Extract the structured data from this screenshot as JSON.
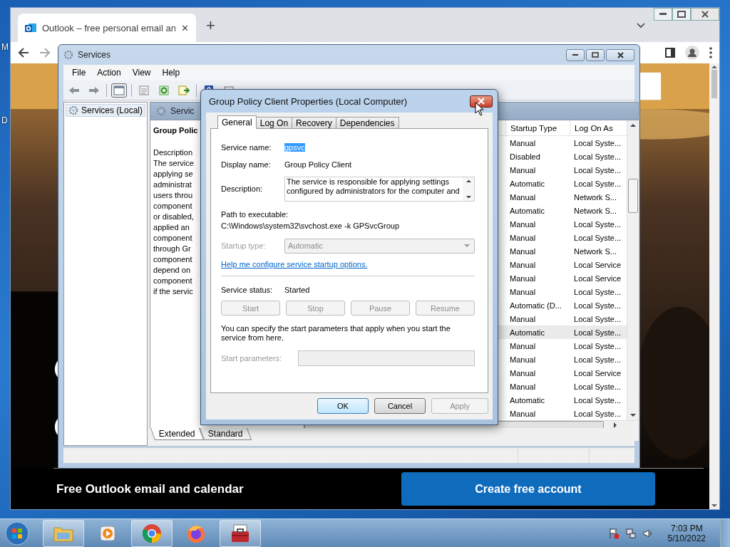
{
  "desktop": {
    "icon_labels": [
      "M",
      "D"
    ]
  },
  "browser": {
    "tab": {
      "title": "Outlook – free personal email an",
      "close": "✕"
    },
    "new_tab": "+",
    "page": {
      "kind": "picture",
      "headline": "Free Outlook email and calendar",
      "cta": "Create free account"
    }
  },
  "services_window": {
    "title": "Services",
    "menu": [
      "File",
      "Action",
      "View",
      "Help"
    ],
    "tree": [
      {
        "label": "Services (Local)",
        "selected": true
      }
    ],
    "pane_header": "Servic",
    "service_title": "Group Polic",
    "description_lines": [
      "Description",
      "The service",
      "applying se",
      "administrat",
      "users throu",
      "component",
      "or disabled,",
      "applied an",
      "component",
      "through Gr",
      "component",
      "depend on",
      "component",
      "if the servic"
    ],
    "columns": [
      "Startup Type",
      "Log On As"
    ],
    "rows": [
      {
        "startup_type": "Manual",
        "log_on_as": "Local Syste...",
        "selected": false
      },
      {
        "startup_type": "Disabled",
        "log_on_as": "Local Syste...",
        "selected": false
      },
      {
        "startup_type": "Manual",
        "log_on_as": "Local Syste...",
        "selected": false
      },
      {
        "startup_type": "Automatic",
        "log_on_as": "Local Syste...",
        "selected": false
      },
      {
        "startup_type": "Manual",
        "log_on_as": "Network S...",
        "selected": false
      },
      {
        "startup_type": "Automatic",
        "log_on_as": "Network S...",
        "selected": false
      },
      {
        "startup_type": "Manual",
        "log_on_as": "Local Syste...",
        "selected": false
      },
      {
        "startup_type": "Manual",
        "log_on_as": "Local Syste...",
        "selected": false
      },
      {
        "startup_type": "Manual",
        "log_on_as": "Network S...",
        "selected": false
      },
      {
        "startup_type": "Manual",
        "log_on_as": "Local Service",
        "selected": false
      },
      {
        "startup_type": "Manual",
        "log_on_as": "Local Service",
        "selected": false
      },
      {
        "startup_type": "Manual",
        "log_on_as": "Local Syste...",
        "selected": false
      },
      {
        "startup_type": "Automatic (D...",
        "log_on_as": "Local Syste...",
        "selected": false
      },
      {
        "startup_type": "Manual",
        "log_on_as": "Local Syste...",
        "selected": false
      },
      {
        "startup_type": "Automatic",
        "log_on_as": "Local Syste...",
        "selected": true
      },
      {
        "startup_type": "Manual",
        "log_on_as": "Local Syste...",
        "selected": false
      },
      {
        "startup_type": "Manual",
        "log_on_as": "Local Syste...",
        "selected": false
      },
      {
        "startup_type": "Manual",
        "log_on_as": "Local Service",
        "selected": false
      },
      {
        "startup_type": "Manual",
        "log_on_as": "Local Syste...",
        "selected": false
      },
      {
        "startup_type": "Automatic",
        "log_on_as": "Local Syste...",
        "selected": false
      },
      {
        "startup_type": "Manual",
        "log_on_as": "Local Syste...",
        "selected": false
      }
    ],
    "view_tabs": [
      {
        "label": "Extended",
        "selected": true
      },
      {
        "label": "Standard",
        "selected": false
      }
    ]
  },
  "dialog": {
    "title": "Group Policy Client Properties (Local Computer)",
    "tabs": [
      {
        "label": "General",
        "selected": true
      },
      {
        "label": "Log On",
        "selected": false
      },
      {
        "label": "Recovery",
        "selected": false
      },
      {
        "label": "Dependencies",
        "selected": false
      }
    ],
    "service_name": {
      "label": "Service name:",
      "value": "gpsvc",
      "selected": true
    },
    "display_name": {
      "label": "Display name:",
      "value": "Group Policy Client"
    },
    "description": {
      "label": "Description:",
      "lines": [
        "The service is responsible for applying settings",
        "configured by administrators for the computer and"
      ]
    },
    "path": {
      "label": "Path to executable:",
      "value": "C:\\Windows\\system32\\svchost.exe -k GPSvcGroup"
    },
    "startup_type": {
      "label": "Startup type:",
      "value": "Automatic",
      "disabled": true
    },
    "help_link": "Help me configure service startup options.",
    "status": {
      "label": "Service status:",
      "value": "Started"
    },
    "control_buttons": [
      {
        "label": "Start",
        "disabled": true
      },
      {
        "label": "Stop",
        "disabled": true
      },
      {
        "label": "Pause",
        "disabled": true
      },
      {
        "label": "Resume",
        "disabled": true
      }
    ],
    "note": "You can specify the start parameters that apply when you start the service from here.",
    "start_parameters": {
      "label": "Start parameters:",
      "disabled": true
    },
    "buttons": [
      {
        "label": "OK",
        "disabled": false,
        "default": true
      },
      {
        "label": "Cancel",
        "disabled": false,
        "default": false
      },
      {
        "label": "Apply",
        "disabled": true,
        "default": false
      }
    ]
  },
  "taskbar": {
    "apps": [
      {
        "kind": "explorer",
        "open": true
      },
      {
        "kind": "media",
        "open": false
      },
      {
        "kind": "chrome",
        "open": true
      },
      {
        "kind": "firefox",
        "open": false
      },
      {
        "kind": "toolbox",
        "open": true
      }
    ],
    "clock": {
      "time": "7:03 PM",
      "date": "5/10/2022"
    }
  }
}
